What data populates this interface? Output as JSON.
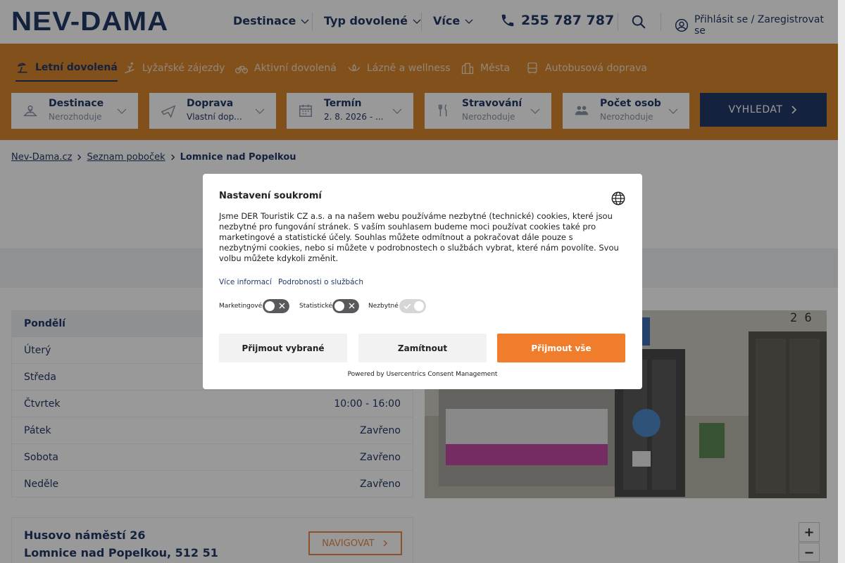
{
  "header": {
    "logo": "NEV-DAMA",
    "nav": [
      "Destinace",
      "Typ dovolené",
      "Více"
    ],
    "phone": "255 787 787",
    "login": "Přihlásit se / Zaregistrovat se"
  },
  "tabs": [
    {
      "label": "Letní dovolená",
      "icon": "beach-icon"
    },
    {
      "label": "Lyžařské zájezdy",
      "icon": "skier-icon"
    },
    {
      "label": "Aktivní dovolená",
      "icon": "bike-icon"
    },
    {
      "label": "Lázně a wellness",
      "icon": "spa-icon"
    },
    {
      "label": "Města",
      "icon": "city-icon"
    },
    {
      "label": "Autobusová doprava",
      "icon": "bus-icon"
    }
  ],
  "search": {
    "fields": [
      {
        "title": "Destinace",
        "value": "Nerozhoduje"
      },
      {
        "title": "Doprava",
        "value": "Vlastní dop..."
      },
      {
        "title": "Termín",
        "value": "2. 8. 2026 - ..."
      },
      {
        "title": "Stravování",
        "value": "Nerozhoduje"
      },
      {
        "title": "Počet osob",
        "value": "Nerozhoduje"
      }
    ],
    "submit": "VYHLEDAT"
  },
  "breadcrumb": [
    "Nev-Dama.cz",
    "Seznam poboček",
    "Lomnice nad Popelkou"
  ],
  "hours": [
    {
      "day": "Pondělí",
      "time": ""
    },
    {
      "day": "Úterý",
      "time": ""
    },
    {
      "day": "Středa",
      "time": ""
    },
    {
      "day": "Čtvrtek",
      "time": "10:00 - 16:00"
    },
    {
      "day": "Pátek",
      "time": "Zavřeno"
    },
    {
      "day": "Sobota",
      "time": "Zavřeno"
    },
    {
      "day": "Neděle",
      "time": "Zavřeno"
    }
  ],
  "photo": {
    "house_number": "2 6"
  },
  "address": {
    "line1": "Husovo náměstí 26",
    "line2": "Lomnice nad Popelkou, 512 51",
    "navigate": "NAVIGOVAT"
  },
  "map": {
    "zoom_in": "+",
    "zoom_out": "−"
  },
  "consent": {
    "title": "Nastavení soukromí",
    "text": "Jsme DER Touristik CZ a.s. a na našem webu používáme nezbytné (technické) cookies, které jsou nezbytné pro fungování stránek. S vaším souhlasem budeme moci používat cookies také pro marketingové a statistické účely. Souhlas můžete odmítnout a pokračovat dále pouze s nezbytnými cookies, nebo si můžete v podrobnostech o službách vybrat, které nám povolíte. Svou volbu můžete kdykoli změnit.",
    "link_more": "Více informací",
    "link_details": "Podrobnosti o službách",
    "toggles": [
      {
        "label": "Marketingové",
        "on": false
      },
      {
        "label": "Statistické",
        "on": false
      },
      {
        "label": "Nezbytné",
        "on": true
      }
    ],
    "btn_selected": "Přijmout vybrané",
    "btn_reject": "Zamítnout",
    "btn_accept": "Přijmout vše",
    "powered": "Powered by Usercentrics Consent Management"
  },
  "colors": {
    "brand": "#233a66",
    "band": "#d8862e",
    "accent": "#f07d2c"
  }
}
